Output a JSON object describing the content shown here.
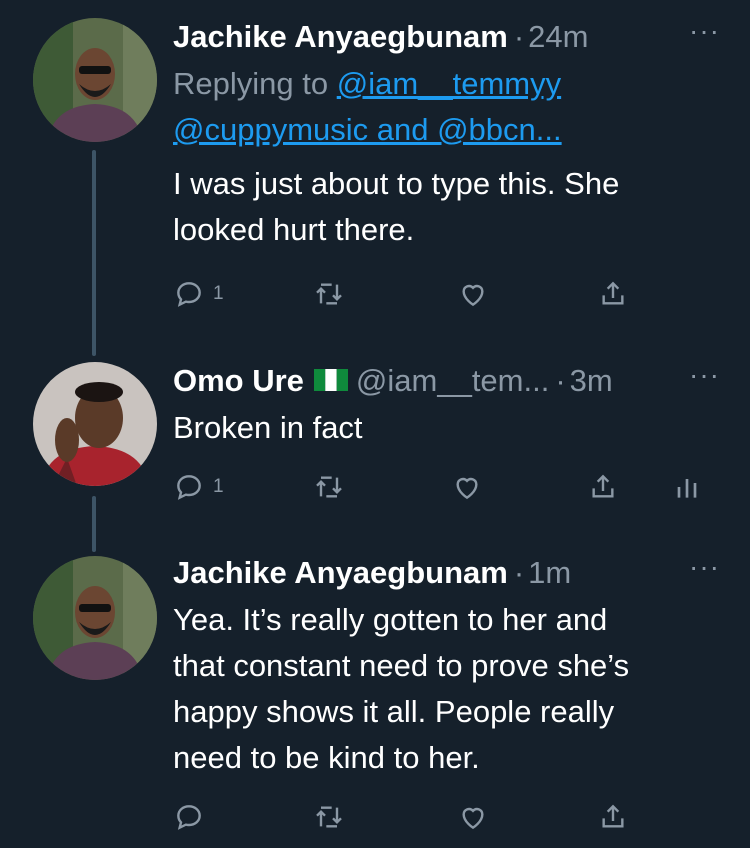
{
  "tweets": [
    {
      "name": "Jachike Anyaegbunam",
      "time": "24m",
      "replying_prefix": "Replying to",
      "replying_link1": "@iam__temmyy",
      "replying_link2": "@cuppymusic and @bbcn...",
      "text_lines": [
        "I was just about to type this. She",
        "looked hurt there."
      ],
      "reply_count": "1"
    },
    {
      "name": "Omo Ure",
      "handle": "@iam__tem...",
      "time": "3m",
      "text_lines": [
        "Broken in fact"
      ],
      "reply_count": "1"
    },
    {
      "name": "Jachike Anyaegbunam",
      "time": "1m",
      "text_lines": [
        "Yea. It’s really gotten to her and",
        "that constant need to prove she’s",
        "happy shows it all. People really",
        "need to be kind to her."
      ]
    }
  ],
  "ui": {
    "separator": "·",
    "more_label": "···"
  },
  "colors": {
    "background": "#15202b",
    "text": "#ffffff",
    "secondary": "#8b98a5",
    "link": "#1d9bf0",
    "thread_line": "#3d5466"
  }
}
